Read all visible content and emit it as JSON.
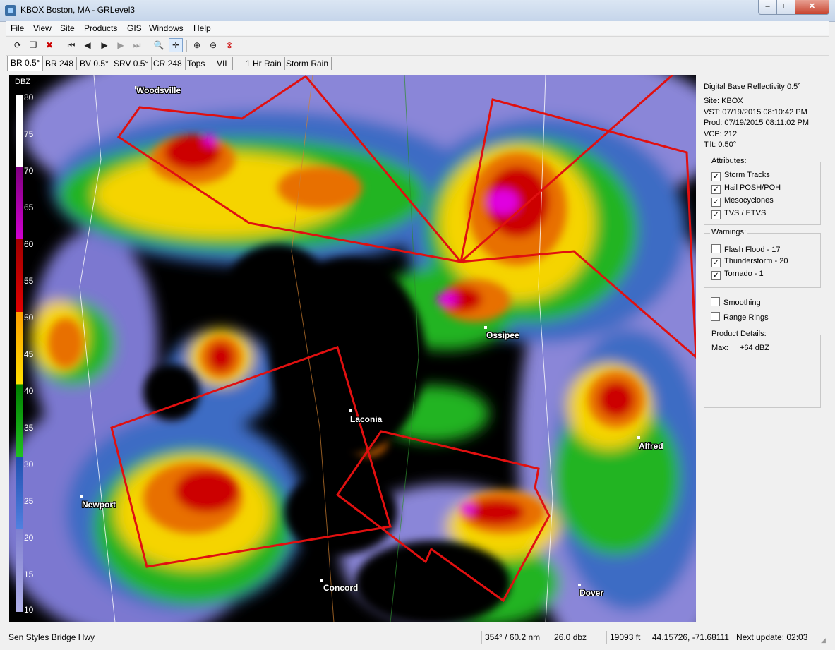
{
  "window": {
    "title": "KBOX Boston, MA - GRLevel3",
    "controls": {
      "minimize": "–",
      "maximize": "□",
      "close": "✕"
    }
  },
  "menu": [
    "File",
    "View",
    "Site",
    "Products",
    "GIS",
    "Windows",
    "Help"
  ],
  "toolbar": {
    "icons": [
      "refresh-icon",
      "copy-icon",
      "stop-icon",
      "first-frame-icon",
      "prev-frame-icon",
      "play-icon",
      "next-frame-icon",
      "last-frame-icon",
      "zoom-icon",
      "pan-icon",
      "zoom-in-icon",
      "zoom-out-icon",
      "zoom-reset-icon"
    ],
    "glyphs": {
      "first": "⏮",
      "prev": "◀",
      "play": "▶",
      "next": "▶",
      "last": "⏭"
    }
  },
  "tabs": [
    "BR 0.5°",
    "BR 248",
    "BV 0.5°",
    "SRV 0.5°",
    "CR 248",
    "Tops",
    "VIL",
    "1 Hr Rain",
    "Storm Rain"
  ],
  "active_tab": "BR 0.5°",
  "scale": {
    "unit": "DBZ",
    "ticks": [
      "80",
      "75",
      "70",
      "65",
      "60",
      "55",
      "50",
      "45",
      "40",
      "35",
      "30",
      "25",
      "20",
      "15",
      "10"
    ]
  },
  "map": {
    "cities": [
      "Woodsville",
      "Ossipee",
      "Laconia",
      "Alfred",
      "Newport",
      "Concord",
      "Dover"
    ]
  },
  "panel": {
    "product": "Digital Base Reflectivity 0.5°",
    "site": "Site:  KBOX",
    "vst": "VST:  07/19/2015  08:10:42 PM",
    "prod": "Prod:  07/19/2015  08:11:02 PM",
    "vcp": "VCP:  212",
    "tilt": "Tilt:   0.50°",
    "attributes_title": "Attributes:",
    "attributes": [
      {
        "label": "Storm Tracks",
        "checked": true
      },
      {
        "label": "Hail POSH/POH",
        "checked": true
      },
      {
        "label": "Mesocyclones",
        "checked": true
      },
      {
        "label": "TVS / ETVS",
        "checked": true
      }
    ],
    "warnings_title": "Warnings:",
    "warnings": [
      {
        "label": "Flash Flood - 17",
        "checked": false
      },
      {
        "label": "Thunderstorm - 20",
        "checked": true
      },
      {
        "label": "Tornado - 1",
        "checked": true
      }
    ],
    "options": [
      {
        "label": "Smoothing",
        "checked": false
      },
      {
        "label": "Range Rings",
        "checked": false
      }
    ],
    "details_title": "Product Details:",
    "max_label": "Max:",
    "max_value": "+64 dBZ"
  },
  "status": {
    "location": "Sen Styles Bridge Hwy",
    "bearing": "354° / 60.2 nm",
    "dbz": "26.0 dbz",
    "height": "19093 ft",
    "coords": "44.15726, -71.68111",
    "next_update": "Next update: 02:03"
  }
}
